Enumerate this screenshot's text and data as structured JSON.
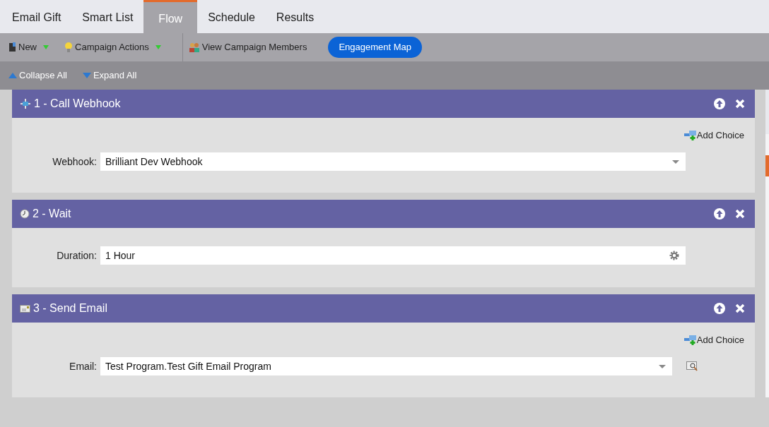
{
  "tabs": [
    {
      "label": "Email Gift",
      "selected": false
    },
    {
      "label": "Smart List",
      "selected": false
    },
    {
      "label": "Flow",
      "selected": true
    },
    {
      "label": "Schedule",
      "selected": false
    },
    {
      "label": "Results",
      "selected": false
    }
  ],
  "toolbar": [
    {
      "kind": "menu",
      "label": "New"
    },
    {
      "kind": "menu",
      "label": "Campaign Actions"
    },
    {
      "kind": "divider"
    },
    {
      "kind": "plain",
      "label": "View Campaign Members"
    },
    {
      "kind": "pill",
      "label": "Engagement Map"
    }
  ],
  "subtoolbar": [
    {
      "kind": "collapse",
      "label": "Collapse All"
    },
    {
      "kind": "expand",
      "label": "Expand All"
    }
  ],
  "steps": [
    {
      "kind": "webhook",
      "title": "1 - Call Webhook",
      "add_choice": "Add Choice",
      "field_label": "Webhook:",
      "value": "Brilliant Dev Webhook"
    },
    {
      "kind": "wait",
      "title": "2 - Wait",
      "field_label": "Duration:",
      "value": "1 Hour"
    },
    {
      "kind": "email",
      "title": "3 - Send Email",
      "add_choice": "Add Choice",
      "field_label": "Email:",
      "value": "Test Program.Test Gift Email Program"
    }
  ]
}
